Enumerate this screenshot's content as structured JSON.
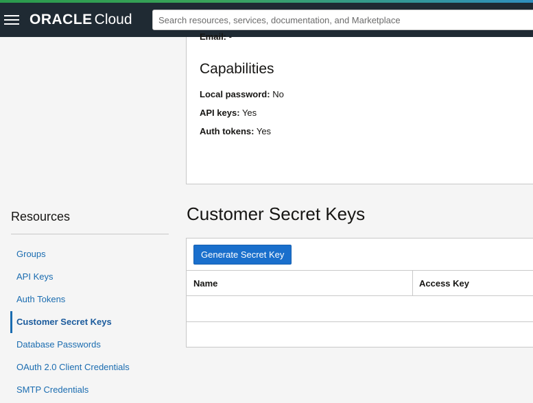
{
  "header": {
    "brand": "ORACLE",
    "product": "Cloud",
    "search_placeholder": "Search resources, services, documentation, and Marketplace"
  },
  "user_details": {
    "email_label": "Email:",
    "email_value": "-"
  },
  "capabilities": {
    "title": "Capabilities",
    "items": [
      {
        "label": "Local password:",
        "value": "No"
      },
      {
        "label": "API keys:",
        "value": "Yes"
      },
      {
        "label": "Auth tokens:",
        "value": "Yes"
      }
    ]
  },
  "resources": {
    "title": "Resources",
    "items": [
      {
        "label": "Groups"
      },
      {
        "label": "API Keys"
      },
      {
        "label": "Auth Tokens"
      },
      {
        "label": "Customer Secret Keys"
      },
      {
        "label": "Database Passwords"
      },
      {
        "label": "OAuth 2.0 Client Credentials"
      },
      {
        "label": "SMTP Credentials"
      }
    ],
    "active": "Customer Secret Keys"
  },
  "main": {
    "title": "Customer Secret Keys",
    "generate_button": "Generate Secret Key",
    "columns": [
      "Name",
      "Access Key"
    ]
  },
  "colors": {
    "topbar": "#1f2a33",
    "link": "#1a6cb0",
    "primary_button": "#1a6fcc"
  }
}
